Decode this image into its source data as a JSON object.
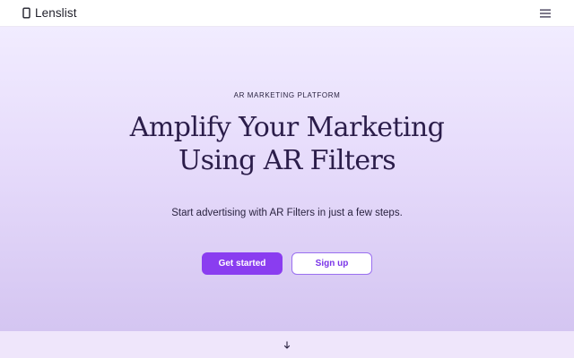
{
  "navbar": {
    "brand_name": "Lenslist",
    "logo_icon": "lens-logo-icon",
    "menu_icon": "hamburger-menu-icon"
  },
  "hero": {
    "eyebrow": "AR MARKETING PLATFORM",
    "headline_line1": "Amplify Your Marketing",
    "headline_line2": "Using AR Filters",
    "subtitle": "Start advertising with AR Filters in just a few steps.",
    "primary_button": "Get started",
    "secondary_button": "Sign up"
  },
  "footer": {
    "scroll_icon": "arrow-down-icon"
  },
  "colors": {
    "accent": "#8a3df0",
    "headline": "#2b1d4a",
    "hero_top": "#f1ecff",
    "hero_bottom": "#d4c5f1",
    "band": "#efe6fb"
  }
}
